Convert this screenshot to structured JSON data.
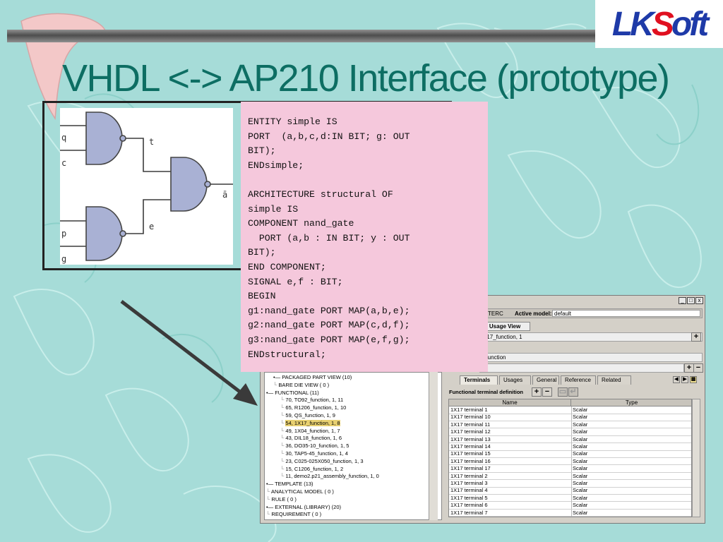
{
  "title": "VHDL <-> AP210 Interface (prototype)",
  "logo": {
    "lk": "LK",
    "s": "S",
    "oft": "oft"
  },
  "circuit": {
    "inputs": [
      "q",
      "c",
      "p",
      "g"
    ],
    "nets": [
      "t",
      "e"
    ],
    "output": "ā"
  },
  "vhdl_code": "ENTITY simple IS\nPORT  (a,b,c,d:IN BIT; g: OUT\nBIT);\nENDsimple;\n\nARCHITECTURE structural OF\nsimple IS\nCOMPONENT nand_gate\n  PORT (a,b : IN BIT; y : OUT\nBIT);\nEND COMPONENT;\nSIGNAL e,f : BIT;\nBEGIN\ng1:nand_gate PORT MAP(a,b,e);\ng2:nand_gate PORT MAP(c,d,f);\ng3:nand_gate PORT MAP(e,f,g);\nENDstructural;",
  "app": {
    "window_buttons": [
      "_",
      "□",
      "x"
    ],
    "model_bar": {
      "left": "INTERC",
      "label": "Active model:",
      "value": "default"
    },
    "usage_tab": "al Usage View",
    "row1": "X17_function, 1",
    "row2": "_function",
    "tree": [
      {
        "text": "PACKAGED PART VIEW (10)",
        "indent": 1,
        "toggle": true
      },
      {
        "text": "BARE DIE VIEW ( 0 )",
        "indent": 1
      },
      {
        "text": "FUNCTIONAL (11)",
        "indent": 0,
        "toggle": true
      },
      {
        "text": "70, TO92_function, 1, 11",
        "indent": 2
      },
      {
        "text": "65, R1206_function, 1, 10",
        "indent": 2
      },
      {
        "text": "59, QS_function, 1, 9",
        "indent": 2
      },
      {
        "text": "54, 1X17_function, 1, 8",
        "indent": 2,
        "selected": true
      },
      {
        "text": "49, 1X04_function, 1, 7",
        "indent": 2
      },
      {
        "text": "43, DIL18_function, 1, 6",
        "indent": 2
      },
      {
        "text": "36, DO35-10_function, 1, 5",
        "indent": 2
      },
      {
        "text": "30, TAP5-45_function, 1, 4",
        "indent": 2
      },
      {
        "text": "23, C025-025X050_function, 1, 3",
        "indent": 2
      },
      {
        "text": "15, C1206_function, 1, 2",
        "indent": 2
      },
      {
        "text": "11, demo2.p21_assembly_function, 1, 0",
        "indent": 2
      },
      {
        "text": "TEMPLATE (13)",
        "indent": 0,
        "toggle": true
      },
      {
        "text": "ANALYTICAL MODEL ( 0 )",
        "indent": 0
      },
      {
        "text": "RULE ( 0 )",
        "indent": 0
      },
      {
        "text": "EXTERNAL (LIBRARY) (20)",
        "indent": 0,
        "toggle": true
      },
      {
        "text": "REQUIREMENT ( 0 )",
        "indent": 0
      }
    ],
    "tabs": [
      "Terminals",
      "Usages",
      "General",
      "Reference",
      "Related"
    ],
    "section_title": "Functional terminal definition",
    "columns": [
      "Name",
      "Type"
    ],
    "rows": [
      [
        "1X17 terminal 1",
        "Scalar"
      ],
      [
        "1X17 terminal 10",
        "Scalar"
      ],
      [
        "1X17 terminal 11",
        "Scalar"
      ],
      [
        "1X17 terminal 12",
        "Scalar"
      ],
      [
        "1X17 terminal 13",
        "Scalar"
      ],
      [
        "1X17 terminal 14",
        "Scalar"
      ],
      [
        "1X17 terminal 15",
        "Scalar"
      ],
      [
        "1X17 terminal 16",
        "Scalar"
      ],
      [
        "1X17 terminal 17",
        "Scalar"
      ],
      [
        "1X17 terminal 2",
        "Scalar"
      ],
      [
        "1X17 terminal 3",
        "Scalar"
      ],
      [
        "1X17 terminal 4",
        "Scalar"
      ],
      [
        "1X17 terminal 5",
        "Scalar"
      ],
      [
        "1X17 terminal 6",
        "Scalar"
      ],
      [
        "1X17 terminal 7",
        "Scalar"
      ]
    ]
  },
  "colors": {
    "background": "#a6dcd8",
    "title": "#0d6e63",
    "code_box": "#f5c8dc",
    "gate_fill": "#a9b1d4",
    "logo_blue": "#1e3aa8",
    "logo_red": "#e01020"
  }
}
